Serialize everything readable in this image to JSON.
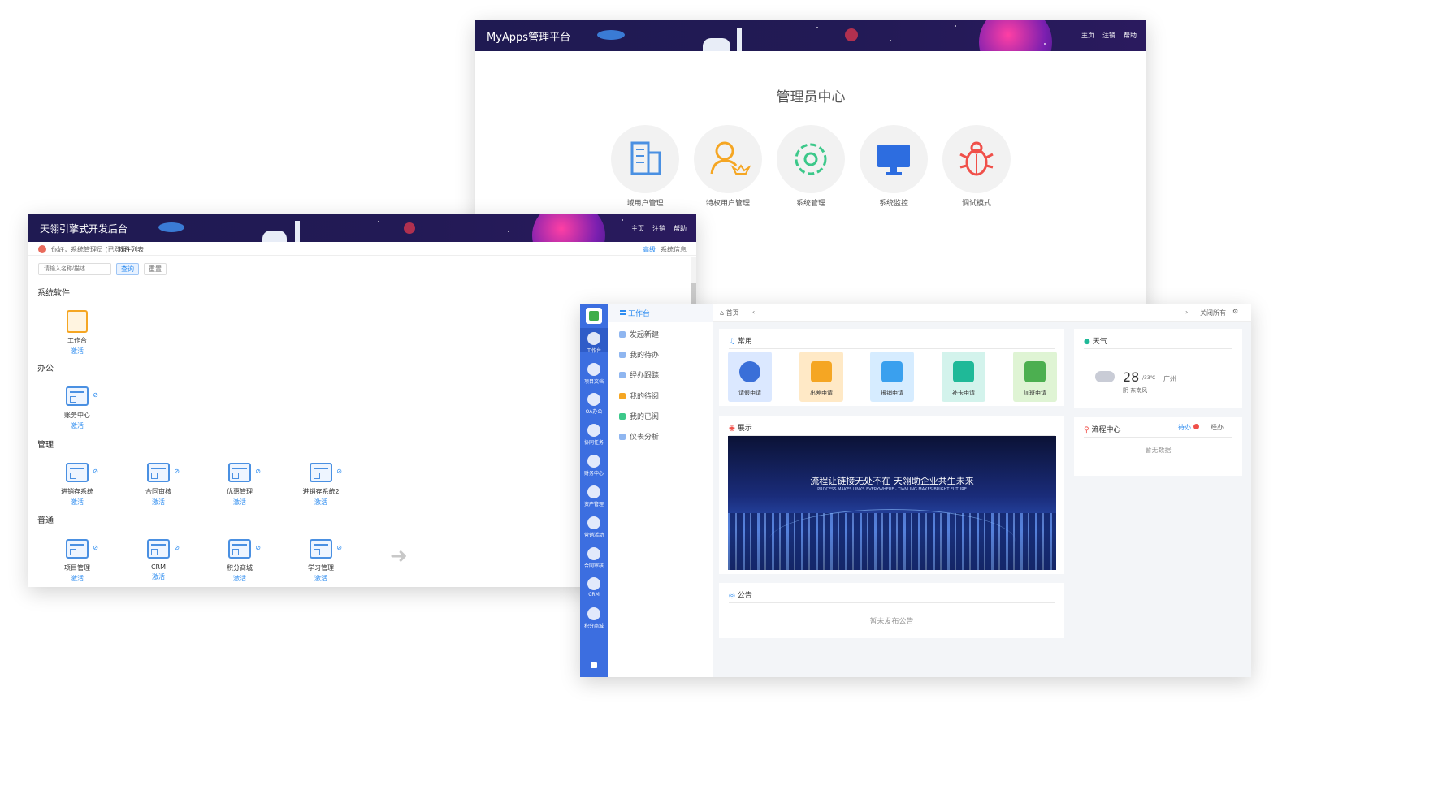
{
  "admin_window": {
    "title": "MyApps管理平台",
    "links": [
      "主页",
      "注销",
      "帮助"
    ],
    "heading": "管理员中心",
    "items": [
      {
        "label": "域用户管理",
        "icon": "building-icon",
        "color": "#4a90e2"
      },
      {
        "label": "特权用户管理",
        "icon": "user-crown-icon",
        "color": "#f5a623"
      },
      {
        "label": "系统管理",
        "icon": "gear-icon",
        "color": "#3cc88a"
      },
      {
        "label": "系统监控",
        "icon": "monitor-icon",
        "color": "#2d6de0"
      },
      {
        "label": "调试模式",
        "icon": "bug-icon",
        "color": "#f0504a"
      }
    ]
  },
  "dev_window": {
    "title": "天翎引擎式开发后台",
    "links": [
      "主页",
      "注销",
      "帮助"
    ],
    "greeting": "你好，系统管理员 (已登录)",
    "breadcrumb": "软件列表",
    "top_right": [
      "高级",
      "系统信息"
    ],
    "search_placeholder": "请输入名称/描述",
    "search_button": "查询",
    "reset_button": "重置",
    "sections": [
      {
        "title": "系统软件",
        "apps": [
          {
            "name": "工作台",
            "status": "激活"
          }
        ]
      },
      {
        "title": "办公",
        "apps": [
          {
            "name": "账务中心",
            "status": "激活"
          }
        ]
      },
      {
        "title": "管理",
        "apps": [
          {
            "name": "进销存系统",
            "status": "激活"
          },
          {
            "name": "合同审核",
            "status": "激活"
          },
          {
            "name": "优惠管理",
            "status": "激活"
          },
          {
            "name": "进销存系统2",
            "status": "激活"
          }
        ]
      },
      {
        "title": "普通",
        "apps": [
          {
            "name": "项目管理",
            "status": "激活"
          },
          {
            "name": "CRM",
            "status": "激活"
          },
          {
            "name": "积分商城",
            "status": "激活"
          },
          {
            "name": "学习管理",
            "status": "激活"
          }
        ]
      }
    ]
  },
  "workbench_window": {
    "rail": [
      "工作台",
      "项目文档",
      "OA办公",
      "协同任务",
      "财务中心",
      "资产管理",
      "营销活动",
      "合同审核",
      "CRM",
      "积分商城"
    ],
    "menu_active": "工作台",
    "menu": [
      "发起新建",
      "我的待办",
      "经办跟踪",
      "我的待阅",
      "我的已阅",
      "仪表分析"
    ],
    "breadcrumb": "首页",
    "close_label": "关闭所有",
    "common_title": "常用",
    "quick_actions": [
      {
        "label": "请假申请",
        "color": "#dbe8ff",
        "icon_color": "#3a6fd8"
      },
      {
        "label": "出差申请",
        "color": "#ffe9c6",
        "icon_color": "#f5a623"
      },
      {
        "label": "报销申请",
        "color": "#d6ecff",
        "icon_color": "#3aa0ee"
      },
      {
        "label": "补卡申请",
        "color": "#d3f3ec",
        "icon_color": "#1fb998"
      },
      {
        "label": "加班申请",
        "color": "#dff4d4",
        "icon_color": "#4caf50"
      }
    ],
    "display_title": "展示",
    "banner_text": "流程让链接无处不在 天翎助企业共生未来",
    "banner_sub": "PROCESS MAKES LINKS EVERYWHERE · TIANLING MAKES BRIGHT FUTURE",
    "notice_title": "公告",
    "notice_empty": "暂未发布公告",
    "weather_title": "天气",
    "weather_temp": "28",
    "weather_range": "/33℃",
    "weather_city": "广州",
    "weather_desc": "阴 东南风",
    "flow_title": "流程中心",
    "flow_tabs": [
      "待办",
      "经办"
    ],
    "flow_empty": "暂无数据"
  }
}
